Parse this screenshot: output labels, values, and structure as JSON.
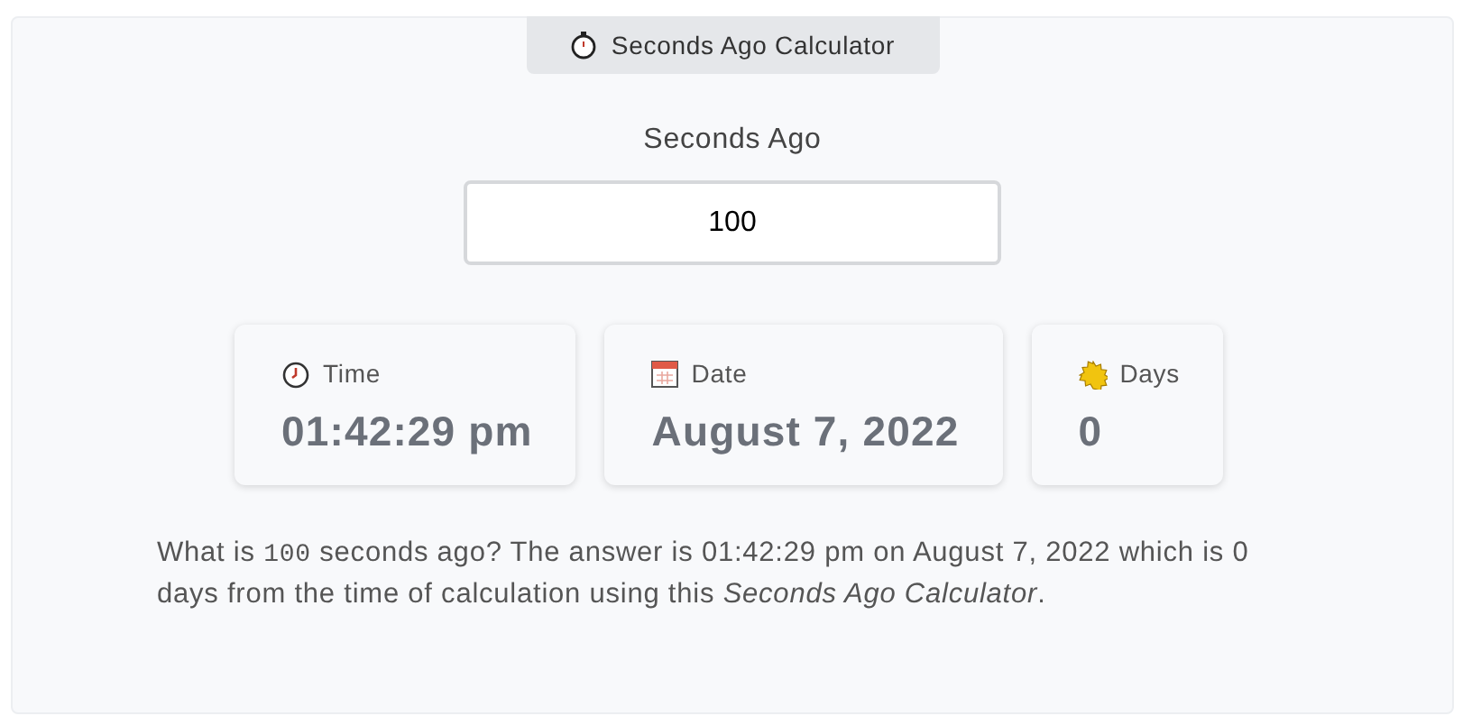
{
  "header_tab": {
    "label": "Seconds Ago Calculator"
  },
  "input": {
    "label": "Seconds Ago",
    "value": "100"
  },
  "results": [
    {
      "kind": "time",
      "label": "Time",
      "value": "01:42:29 pm"
    },
    {
      "kind": "date",
      "label": "Date",
      "value": "August 7, 2022"
    },
    {
      "kind": "days",
      "label": "Days",
      "value": "0"
    }
  ],
  "summary": [
    {
      "kind": "text",
      "text": "What is "
    },
    {
      "kind": "code",
      "text": "100"
    },
    {
      "kind": "text",
      "text": " seconds ago? The answer is 01:42:29 pm on August 7, 2022 which is 0 days from the time of calculation using this "
    },
    {
      "kind": "italic",
      "text": "Seconds Ago Calculator"
    },
    {
      "kind": "text",
      "text": "."
    }
  ]
}
